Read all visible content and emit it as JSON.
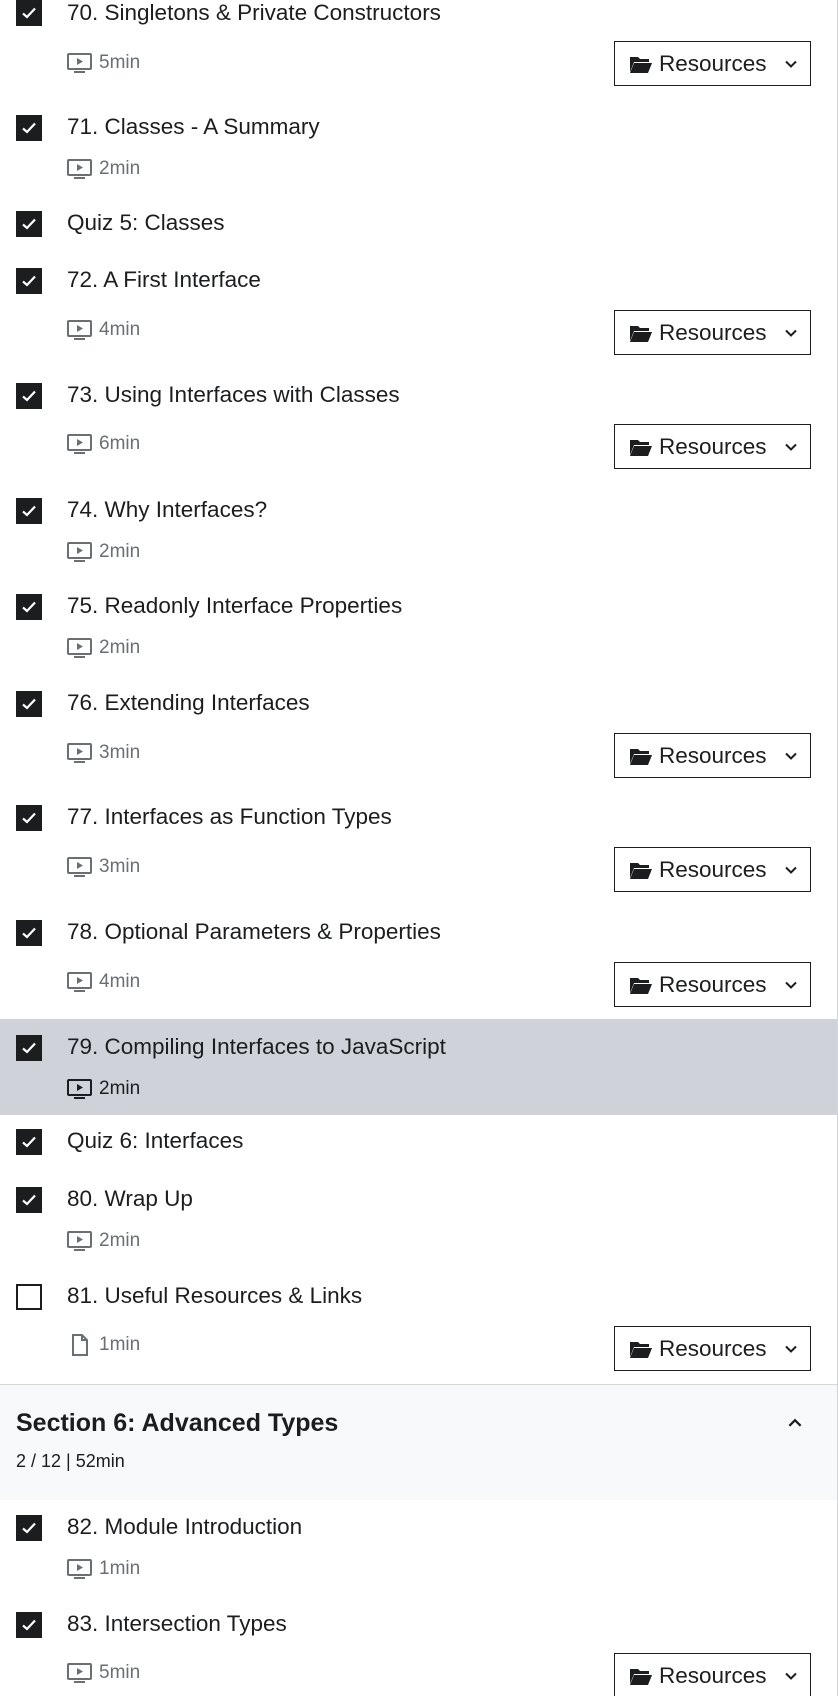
{
  "items": [
    {
      "title": "70. Singletons & Private Constructors",
      "duration": "5min",
      "checked": true,
      "type": "video",
      "resources": "Resources"
    },
    {
      "title": "71. Classes - A Summary",
      "duration": "2min",
      "checked": true,
      "type": "video"
    },
    {
      "title": "Quiz 5: Classes",
      "checked": true,
      "type": "quiz"
    },
    {
      "title": "72. A First Interface",
      "duration": "4min",
      "checked": true,
      "type": "video",
      "resources": "Resources"
    },
    {
      "title": "73. Using Interfaces with Classes",
      "duration": "6min",
      "checked": true,
      "type": "video",
      "resources": "Resources"
    },
    {
      "title": "74. Why Interfaces?",
      "duration": "2min",
      "checked": true,
      "type": "video"
    },
    {
      "title": "75. Readonly Interface Properties",
      "duration": "2min",
      "checked": true,
      "type": "video"
    },
    {
      "title": "76. Extending Interfaces",
      "duration": "3min",
      "checked": true,
      "type": "video",
      "resources": "Resources"
    },
    {
      "title": "77. Interfaces as Function Types",
      "duration": "3min",
      "checked": true,
      "type": "video",
      "resources": "Resources"
    },
    {
      "title": "78. Optional Parameters & Properties",
      "duration": "4min",
      "checked": true,
      "type": "video",
      "resources": "Resources"
    },
    {
      "title": "79. Compiling Interfaces to JavaScript",
      "duration": "2min",
      "checked": true,
      "type": "video",
      "current": true
    },
    {
      "title": "Quiz 6: Interfaces",
      "checked": true,
      "type": "quiz"
    },
    {
      "title": "80. Wrap Up",
      "duration": "2min",
      "checked": true,
      "type": "video"
    },
    {
      "title": "81. Useful Resources & Links",
      "duration": "1min",
      "checked": false,
      "type": "article",
      "resources": "Resources"
    }
  ],
  "section": {
    "title": "Section 6: Advanced Types",
    "progress": "2 / 12 | 52min",
    "toggle_icon": "chevron-up-icon"
  },
  "items_after": [
    {
      "title": "82. Module Introduction",
      "duration": "1min",
      "checked": true,
      "type": "video"
    },
    {
      "title": "83. Intersection Types",
      "duration": "5min",
      "checked": true,
      "type": "video",
      "resources": "Resources"
    }
  ]
}
